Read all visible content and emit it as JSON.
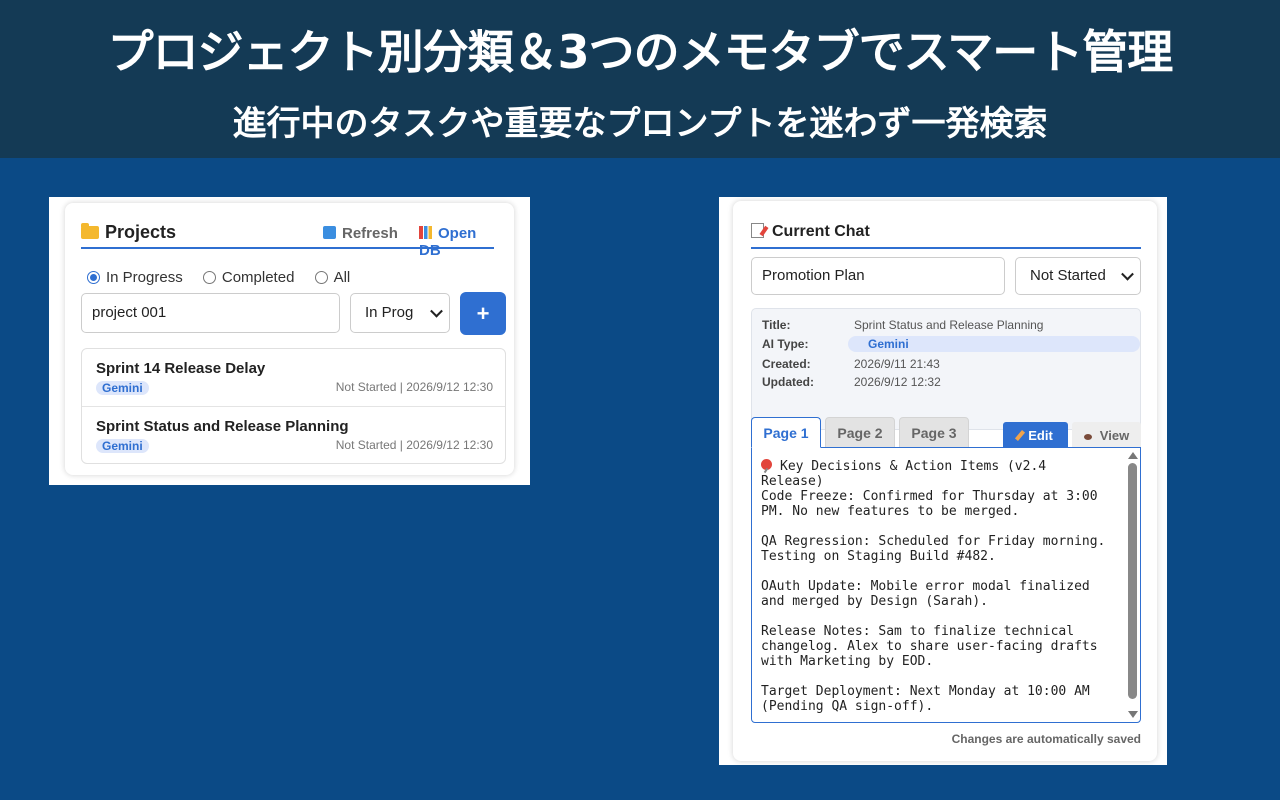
{
  "banner": {
    "headline": "プロジェクト別分類＆3つのメモタブでスマート管理",
    "subheadline": "進行中のタスクや重要なプロンプトを迷わず一発検索"
  },
  "projects": {
    "title": "Projects",
    "refresh_label": "Refresh",
    "open_db_label": "Open DB",
    "filters": [
      {
        "label": "In Progress",
        "checked": true
      },
      {
        "label": "Completed",
        "checked": false
      },
      {
        "label": "All",
        "checked": false
      }
    ],
    "new_project_input": {
      "value": "project 001"
    },
    "status_select": {
      "value": "In Prog"
    },
    "add_button_label": "+",
    "items": [
      {
        "name": "Sprint 14 Release Delay",
        "ai_type": "Gemini",
        "meta": "Not Started | 2026/9/12 12:30"
      },
      {
        "name": "Sprint Status and Release Planning",
        "ai_type": "Gemini",
        "meta": "Not Started | 2026/9/12 12:30"
      }
    ]
  },
  "chat": {
    "title": "Current Chat",
    "project_input": {
      "value": "Promotion Plan"
    },
    "status_select": {
      "value": "Not Started"
    },
    "info": {
      "title_label": "Title:",
      "title_value": "Sprint Status and Release Planning",
      "ai_label": "AI Type:",
      "ai_value": "Gemini",
      "created_label": "Created:",
      "created_value": "2026/9/11 21:43",
      "updated_label": "Updated:",
      "updated_value": "2026/9/12 12:32"
    },
    "tabs": [
      {
        "label": "Page 1",
        "active": true
      },
      {
        "label": "Page 2",
        "active": false
      },
      {
        "label": "Page 3",
        "active": false
      }
    ],
    "edit_label": "Edit",
    "view_label": "View",
    "memo_heading": "Key Decisions & Action Items (v2.4 Release)",
    "memo_body": "\nCode Freeze: Confirmed for Thursday at 3:00 PM. No new features to be merged.\n\nQA Regression: Scheduled for Friday morning. Testing on Staging Build #482.\n\nOAuth Update: Mobile error modal finalized and merged by Design (Sarah).\n\nRelease Notes: Sam to finalize technical changelog. Alex to share user-facing drafts with Marketing by EOD.\n\nTarget Deployment: Next Monday at 10:00 AM (Pending QA sign-off).",
    "autosave_note": "Changes are automatically saved"
  },
  "colors": {
    "banner_bg": "#143a55",
    "page_bg": "#0b4a86",
    "accent": "#2f6fd1"
  }
}
